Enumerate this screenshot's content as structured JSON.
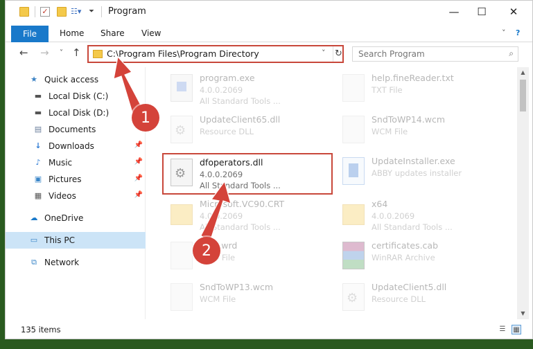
{
  "window": {
    "title": "Program",
    "controls": {
      "minimize": "—",
      "maximize": "☐",
      "close": "✕"
    }
  },
  "ribbon": {
    "tabs": [
      "File",
      "Home",
      "Share",
      "View"
    ],
    "expand": "˅",
    "help": "?"
  },
  "nav": {
    "back": "←",
    "forward": "→",
    "recent": "˅",
    "up": "↑"
  },
  "address": {
    "path": "C:\\Program Files\\Program Directory",
    "dropdown": "˅",
    "refresh": "↻"
  },
  "search": {
    "placeholder": "Search Program"
  },
  "sidebar": {
    "items": [
      {
        "label": "Quick access",
        "icon": "star-icon"
      },
      {
        "label": "Local Disk (C:)",
        "icon": "drive-icon"
      },
      {
        "label": "Local Disk (D:)",
        "icon": "drive-icon"
      },
      {
        "label": "Documents",
        "icon": "documents-icon"
      },
      {
        "label": "Downloads",
        "icon": "download-icon"
      },
      {
        "label": "Music",
        "icon": "music-icon"
      },
      {
        "label": "Pictures",
        "icon": "pictures-icon"
      },
      {
        "label": "Videos",
        "icon": "videos-icon"
      },
      {
        "label": "OneDrive",
        "icon": "cloud-icon"
      },
      {
        "label": "This PC",
        "icon": "computer-icon"
      },
      {
        "label": "Network",
        "icon": "network-icon"
      }
    ]
  },
  "files": [
    {
      "name": "program.exe",
      "line1": "4.0.0.2069",
      "line2": "All Standard Tools ...",
      "type": "exe"
    },
    {
      "name": "help.fineReader.txt",
      "line1": "TXT File",
      "line2": "",
      "type": "doc"
    },
    {
      "name": "UpdateClient65.dll",
      "line1": "Resource DLL",
      "line2": "",
      "type": "dll"
    },
    {
      "name": "SndToWP14.wcm",
      "line1": "WCM File",
      "line2": "",
      "type": "doc"
    },
    {
      "name": "dfoperators.dll",
      "line1": "4.0.0.2069",
      "line2": "All Standard Tools ...",
      "type": "dll"
    },
    {
      "name": "UpdateInstaller.exe",
      "line1": "ABBY updates installer",
      "line2": "",
      "type": "installer"
    },
    {
      "name": "Microsoft.VC90.CRT",
      "line1": "4.0.0.2069",
      "line2": "All Standard Tools ...",
      "type": "folder"
    },
    {
      "name": "x64",
      "line1": "4.0.0.2069",
      "line2": "All Standard Tools ...",
      "type": "folder"
    },
    {
      "name": "pars.wrd",
      "line1": "WRD File",
      "line2": "",
      "type": "doc"
    },
    {
      "name": "certificates.cab",
      "line1": "WinRAR Archive",
      "line2": "",
      "type": "cab"
    },
    {
      "name": "SndToWP13.wcm",
      "line1": "WCM File",
      "line2": "",
      "type": "doc"
    },
    {
      "name": "UpdateClient5.dll",
      "line1": "Resource DLL",
      "line2": "",
      "type": "dll"
    }
  ],
  "status": {
    "count": "135 items"
  },
  "annotations": {
    "step1": "1",
    "step2": "2"
  },
  "colors": {
    "accent": "#1979ca",
    "annotation": "#d4433a",
    "selection": "#cce4f7"
  }
}
